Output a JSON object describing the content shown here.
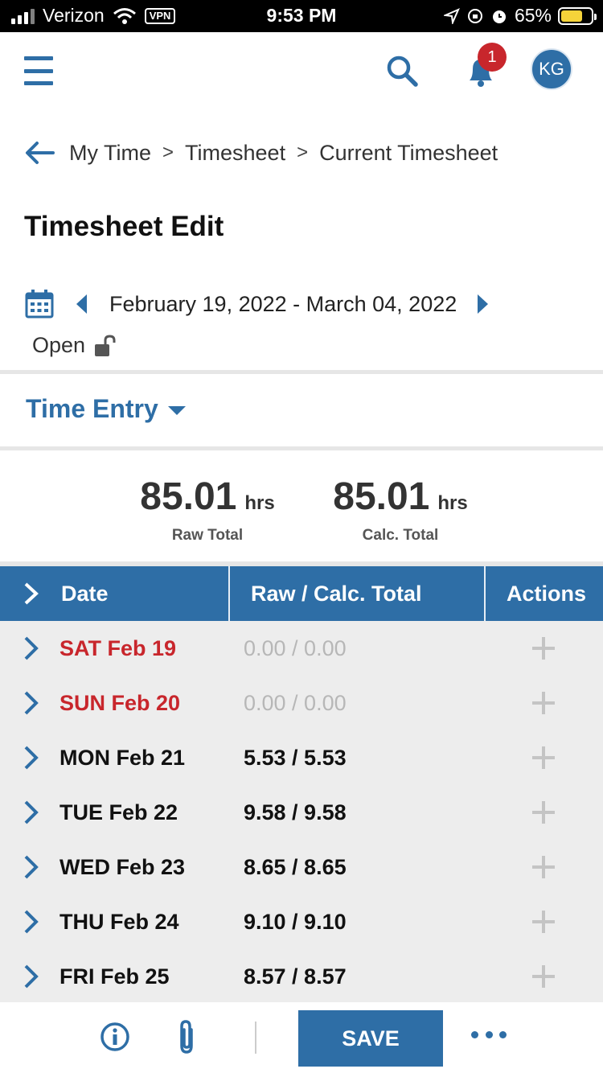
{
  "status_bar": {
    "carrier": "Verizon",
    "vpn": "VPN",
    "time": "9:53 PM",
    "battery": "65%"
  },
  "header": {
    "notification_count": "1",
    "avatar_initials": "KG"
  },
  "breadcrumb": {
    "items": [
      "My Time",
      "Timesheet",
      "Current Timesheet"
    ],
    "separator": ">"
  },
  "page": {
    "title": "Timesheet Edit",
    "date_range": "February 19, 2022 - March 04, 2022",
    "status": "Open"
  },
  "section": {
    "label": "Time Entry"
  },
  "totals": {
    "raw_value": "85.01",
    "raw_unit": "hrs",
    "raw_label": "Raw Total",
    "calc_value": "85.01",
    "calc_unit": "hrs",
    "calc_label": "Calc. Total"
  },
  "table": {
    "headers": [
      "Date",
      "Raw / Calc. Total",
      "Actions"
    ],
    "rows": [
      {
        "day": "SAT Feb 19",
        "total": "0.00 / 0.00"
      },
      {
        "day": "SUN Feb 20",
        "total": "0.00 / 0.00"
      },
      {
        "day": "MON Feb 21",
        "total": "5.53 / 5.53"
      },
      {
        "day": "TUE Feb 22",
        "total": "9.58 / 9.58"
      },
      {
        "day": "WED Feb 23",
        "total": "8.65 / 8.65"
      },
      {
        "day": "THU Feb 24",
        "total": "9.10 / 9.10"
      },
      {
        "day": "FRI Feb 25",
        "total": "8.57 / 8.57"
      }
    ]
  },
  "toolbar": {
    "save_label": "SAVE"
  },
  "colors": {
    "accent": "#2e6ea6",
    "weekend": "#c8262c",
    "badge": "#c8262c",
    "table_bg": "#ededed"
  },
  "icons": [
    "hamburger-icon",
    "search-icon",
    "bell-icon",
    "back-arrow-icon",
    "calendar-icon",
    "chevron-left-icon",
    "chevron-right-icon",
    "unlock-icon",
    "caret-down-icon",
    "info-icon",
    "paperclip-icon",
    "more-icon",
    "plus-icon"
  ]
}
